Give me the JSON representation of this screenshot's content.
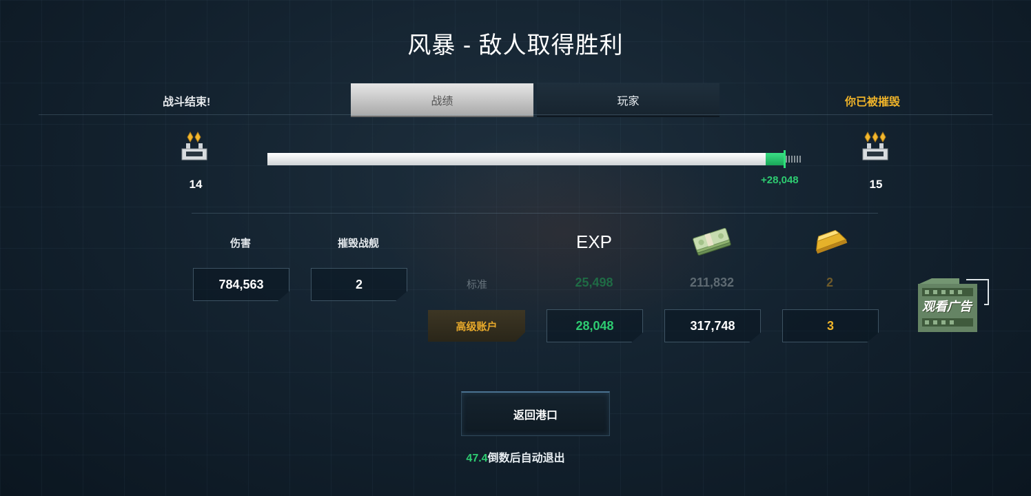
{
  "title": "风暴 - 敌人取得胜利",
  "status": {
    "battle_over": "战斗结束!",
    "player_state": "你已被摧毁"
  },
  "tabs": [
    {
      "label": "战绩",
      "active": true
    },
    {
      "label": "玩家",
      "active": false
    }
  ],
  "rank": {
    "current_level": "14",
    "next_level": "15",
    "xp_gain_text": "+28,048",
    "progress_before": 0.932,
    "progress_after": 0.968
  },
  "stats": {
    "damage_label": "伤害",
    "damage_value": "784,563",
    "kills_label": "摧毁战舰",
    "kills_value": "2"
  },
  "rewards": {
    "exp_label": "EXP",
    "credits_icon": "cash-stack-icon",
    "gold_icon": "gold-bar-icon",
    "standard_label": "标准",
    "standard": {
      "exp": "25,498",
      "credits": "211,832",
      "gold": "2"
    },
    "premium_label": "高级账户",
    "premium": {
      "exp": "28,048",
      "credits": "317,748",
      "gold": "3"
    }
  },
  "ad_button": {
    "label": "观看广告"
  },
  "return_button": {
    "label": "返回港口"
  },
  "countdown": {
    "seconds": "47.4",
    "text": "倒数后自动退出"
  },
  "colors": {
    "accent_green": "#2ecc71",
    "accent_gold": "#f0b429",
    "premium_gold": "#e7a92b",
    "background": "#142330"
  }
}
